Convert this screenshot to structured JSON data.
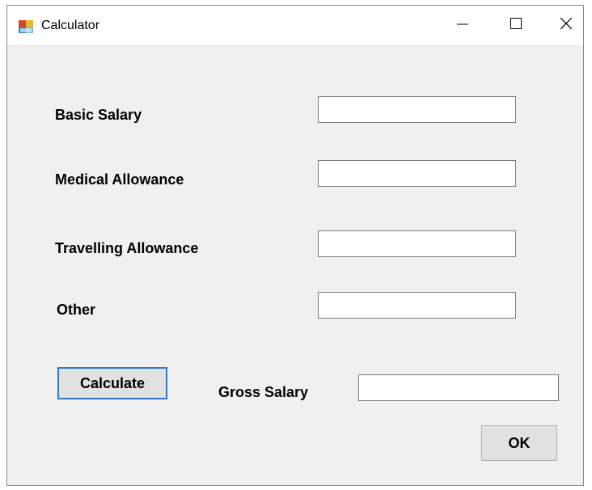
{
  "window": {
    "title": "Calculator"
  },
  "form": {
    "basic_salary_label": "Basic Salary",
    "medical_allowance_label": "Medical Allowance",
    "travelling_allowance_label": "Travelling Allowance",
    "other_label": "Other",
    "gross_salary_label": "Gross Salary",
    "basic_salary_value": "",
    "medical_allowance_value": "",
    "travelling_allowance_value": "",
    "other_value": "",
    "gross_salary_value": ""
  },
  "buttons": {
    "calculate": "Calculate",
    "ok": "OK"
  },
  "icons": {
    "app": "application-icon",
    "minimize": "minimize-icon",
    "maximize": "maximize-icon",
    "close": "close-icon"
  },
  "colors": {
    "accent_border": "#2f79c8",
    "form_bg": "#f0f0f0"
  }
}
